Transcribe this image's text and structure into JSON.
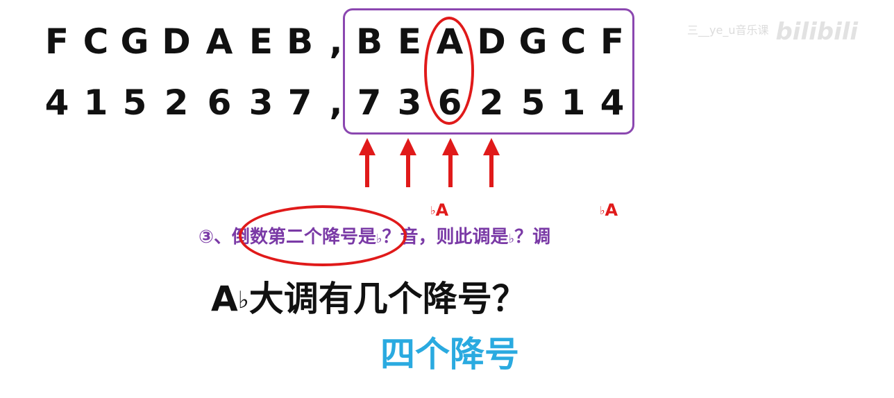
{
  "letters_row": [
    "F",
    "C",
    "G",
    "D",
    "A",
    "E",
    "B",
    ",",
    "B",
    "E",
    "A",
    "D",
    "G",
    "C",
    "F"
  ],
  "numbers_row": [
    "4",
    "1",
    "5",
    "2",
    "6",
    "3",
    "7",
    ",",
    "7",
    "3",
    "6",
    "2",
    "5",
    "1",
    "4"
  ],
  "flat_annotations": [
    {
      "flat": "♭",
      "note": "A"
    },
    {
      "flat": "♭",
      "note": "A"
    }
  ],
  "rule": {
    "prefix": "③、",
    "circled_phrase": "倒数第二个降号",
    "part2": "是",
    "flat1": "♭",
    "part3": "？音，则此调是",
    "flat2": "♭",
    "part4": "？调"
  },
  "question": {
    "note": "A",
    "flat": "♭",
    "text": "大调有几个降号？"
  },
  "answer": "四个降号",
  "watermark": {
    "user": "三__ye_u音乐课",
    "logo": "bilibili"
  },
  "colors": {
    "text": "#111111",
    "box_border": "#8b47b0",
    "highlight_red": "#e01a1a",
    "rule_purple": "#7a3aa6",
    "answer_blue": "#2aaae0"
  }
}
